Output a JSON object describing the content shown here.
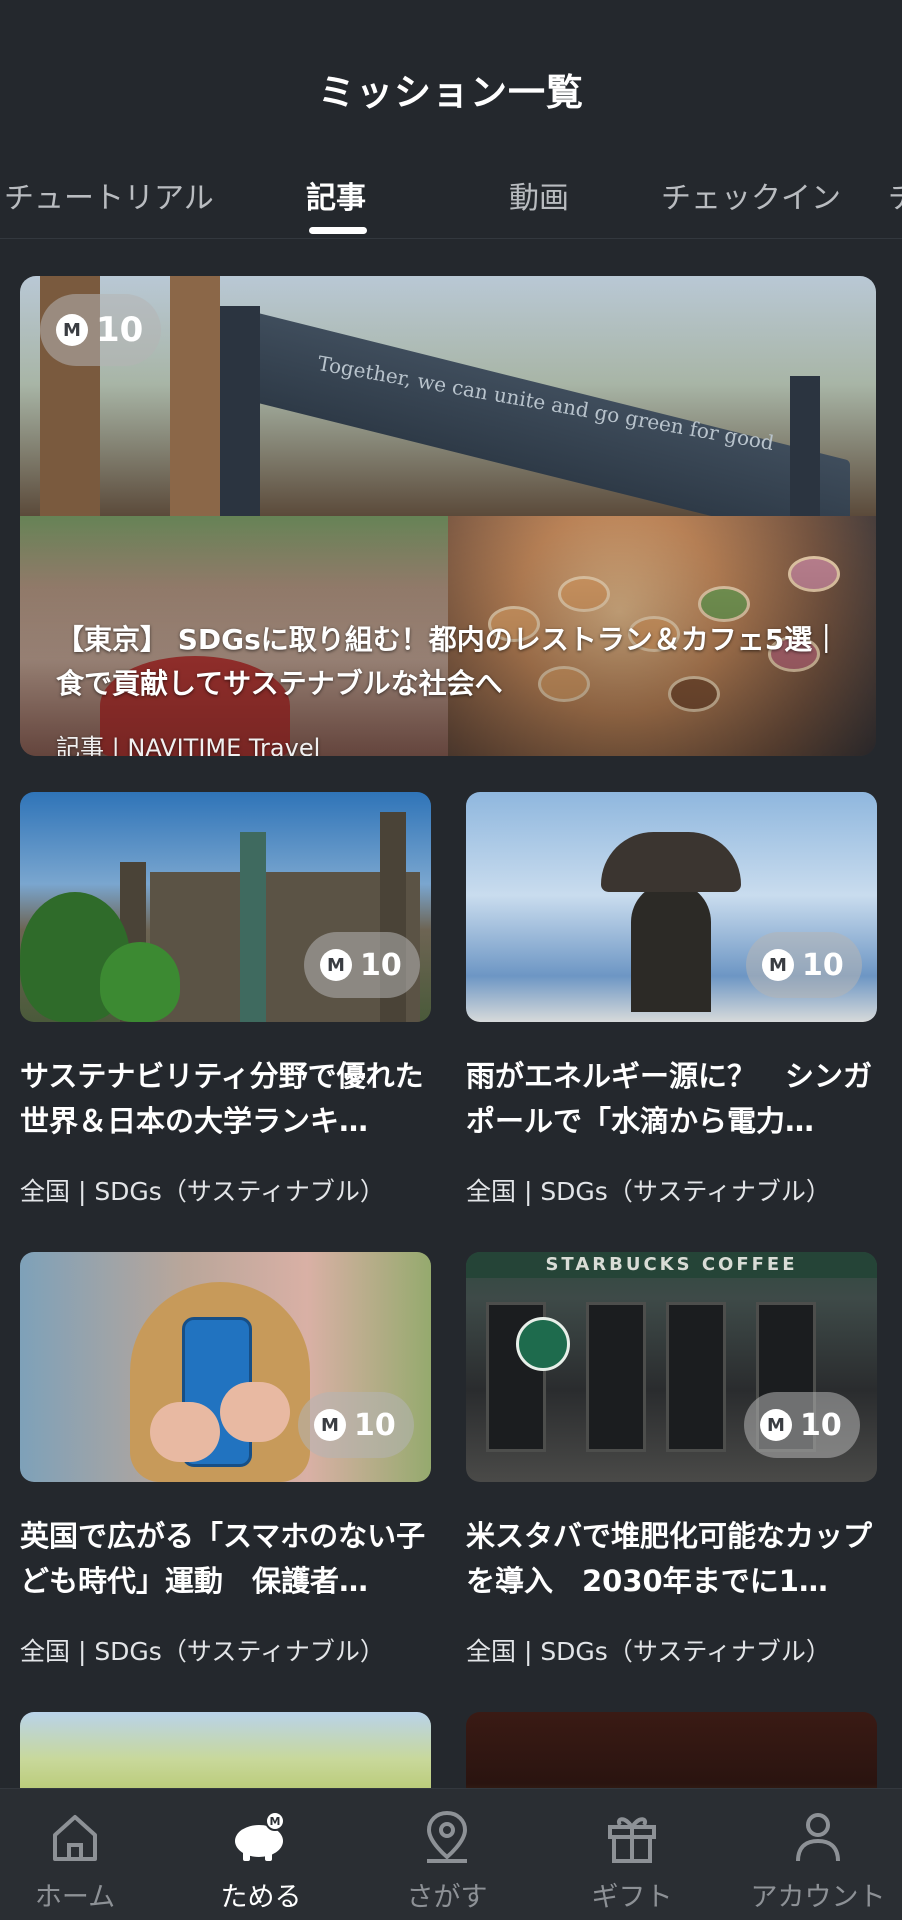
{
  "header": {
    "title": "ミッション一覧"
  },
  "tabs": [
    {
      "label": "チュートリアル"
    },
    {
      "label": "記事"
    },
    {
      "label": "動画"
    },
    {
      "label": "チェックイン"
    },
    {
      "label": "チ"
    }
  ],
  "active_tab": "記事",
  "hero": {
    "points": "10",
    "coin_letter": "M",
    "banner_text": "Together, we can unite and go green for good",
    "title": "【東京】 SDGsに取り組む！都内のレストラン＆カフェ5選｜食で貢献してサステナブルな社会へ",
    "source": "記事 | NAVITIME Travel"
  },
  "cards": [
    {
      "points": "10",
      "title": "サステナビリティ分野で優れた世界＆日本の大学ランキ…",
      "meta": "全国 | SDGs（サスティナブル）"
    },
    {
      "points": "10",
      "title": "雨がエネルギー源に？　シンガポールで「水滴から電力…",
      "meta": "全国 | SDGs（サスティナブル）"
    },
    {
      "points": "10",
      "title": "英国で広がる「スマホのない子ども時代」運動　保護者…",
      "meta": "全国 | SDGs（サスティナブル）"
    },
    {
      "points": "10",
      "title": "米スタバで堆肥化可能なカップを導入　2030年までに1…",
      "meta": "全国 | SDGs（サスティナブル）",
      "sign": "STARBUCKS COFFEE"
    }
  ],
  "bottom_nav": [
    {
      "label": "ホーム",
      "icon": "home-icon"
    },
    {
      "label": "ためる",
      "icon": "piggy-bank-icon"
    },
    {
      "label": "さがす",
      "icon": "map-pin-icon"
    },
    {
      "label": "ギフト",
      "icon": "gift-icon"
    },
    {
      "label": "アカウント",
      "icon": "person-icon"
    }
  ],
  "colors": {
    "background": "#24282d",
    "nav_background": "#2a2e33",
    "text_primary": "#ffffff",
    "text_muted": "#8d9196"
  }
}
